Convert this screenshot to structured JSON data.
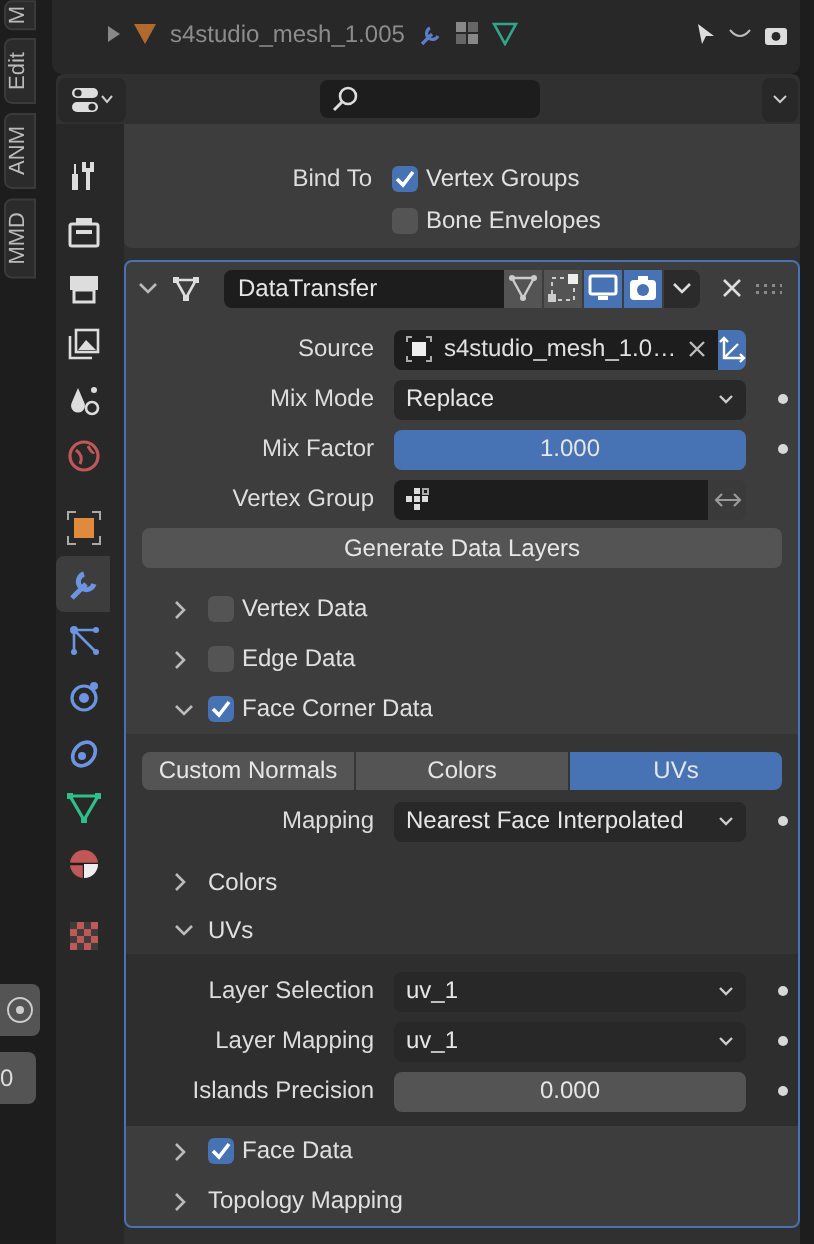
{
  "side_tabs": [
    {
      "label": "M"
    },
    {
      "label": "Edit"
    },
    {
      "label": "ANM"
    },
    {
      "label": "MMD"
    }
  ],
  "side_bottom": {
    "value": "0"
  },
  "outliner": {
    "rows": [
      {
        "name": "s4studio_mesh_1.005"
      }
    ]
  },
  "property_tabs": [
    {
      "kind": "tool",
      "selected": false
    },
    {
      "kind": "render",
      "selected": false
    },
    {
      "kind": "output",
      "selected": false
    },
    {
      "kind": "view_layer",
      "selected": false
    },
    {
      "kind": "scene",
      "selected": false
    },
    {
      "kind": "world",
      "selected": false
    },
    {
      "kind": "object",
      "selected": false
    },
    {
      "kind": "modifier",
      "selected": true
    },
    {
      "kind": "particles",
      "selected": false
    },
    {
      "kind": "physics",
      "selected": false
    },
    {
      "kind": "constraints",
      "selected": false
    },
    {
      "kind": "data",
      "selected": false
    },
    {
      "kind": "material",
      "selected": false
    },
    {
      "kind": "texture",
      "selected": false
    }
  ],
  "previous_modifier": {
    "bind_to": {
      "label": "Bind To",
      "options": [
        {
          "label": "Vertex Groups",
          "checked": true
        },
        {
          "label": "Bone Envelopes",
          "checked": false
        }
      ]
    }
  },
  "modifier": {
    "name": "DataTransfer",
    "expanded": true,
    "toggles": [
      {
        "kind": "vertex",
        "on": false
      },
      {
        "kind": "editmode",
        "on": false
      },
      {
        "kind": "realtime",
        "on": true
      },
      {
        "kind": "render",
        "on": true
      }
    ],
    "fields": [
      {
        "kind": "object",
        "label": "Source",
        "value": "s4studio_mesh_1.0…"
      },
      {
        "kind": "dropdown",
        "label": "Mix Mode",
        "value": "Replace"
      },
      {
        "kind": "slider",
        "label": "Mix Factor",
        "value": "1.000",
        "level": 1
      },
      {
        "kind": "vgroup",
        "label": "Vertex Group"
      }
    ],
    "generate_button": "Generate Data Layers",
    "sections": [
      {
        "label": "Vertex Data",
        "expanded": false,
        "checked": false
      },
      {
        "label": "Edge Data",
        "expanded": false,
        "checked": false
      },
      {
        "label": "Face Corner Data",
        "expanded": true,
        "checked": true,
        "tabs": [
          {
            "label": "Custom Normals",
            "selected": false
          },
          {
            "label": "Colors",
            "selected": false
          },
          {
            "label": "UVs",
            "selected": true
          }
        ],
        "fields": [
          {
            "kind": "dropdown",
            "label": "Mapping",
            "value": "Nearest Face Interpolated"
          }
        ],
        "subsections": [
          {
            "label": "Colors",
            "expanded": false
          },
          {
            "label": "UVs",
            "expanded": true,
            "fields": [
              {
                "kind": "dropdown",
                "label": "Layer Selection",
                "value": "uv_1"
              },
              {
                "kind": "dropdown",
                "label": "Layer Mapping",
                "value": "uv_1"
              },
              {
                "kind": "slider",
                "label": "Islands Precision",
                "value": "0.000",
                "level": 0
              }
            ]
          }
        ]
      },
      {
        "label": "Face Data",
        "expanded": false,
        "checked": true
      },
      {
        "label": "Topology Mapping",
        "expanded": false
      }
    ]
  }
}
